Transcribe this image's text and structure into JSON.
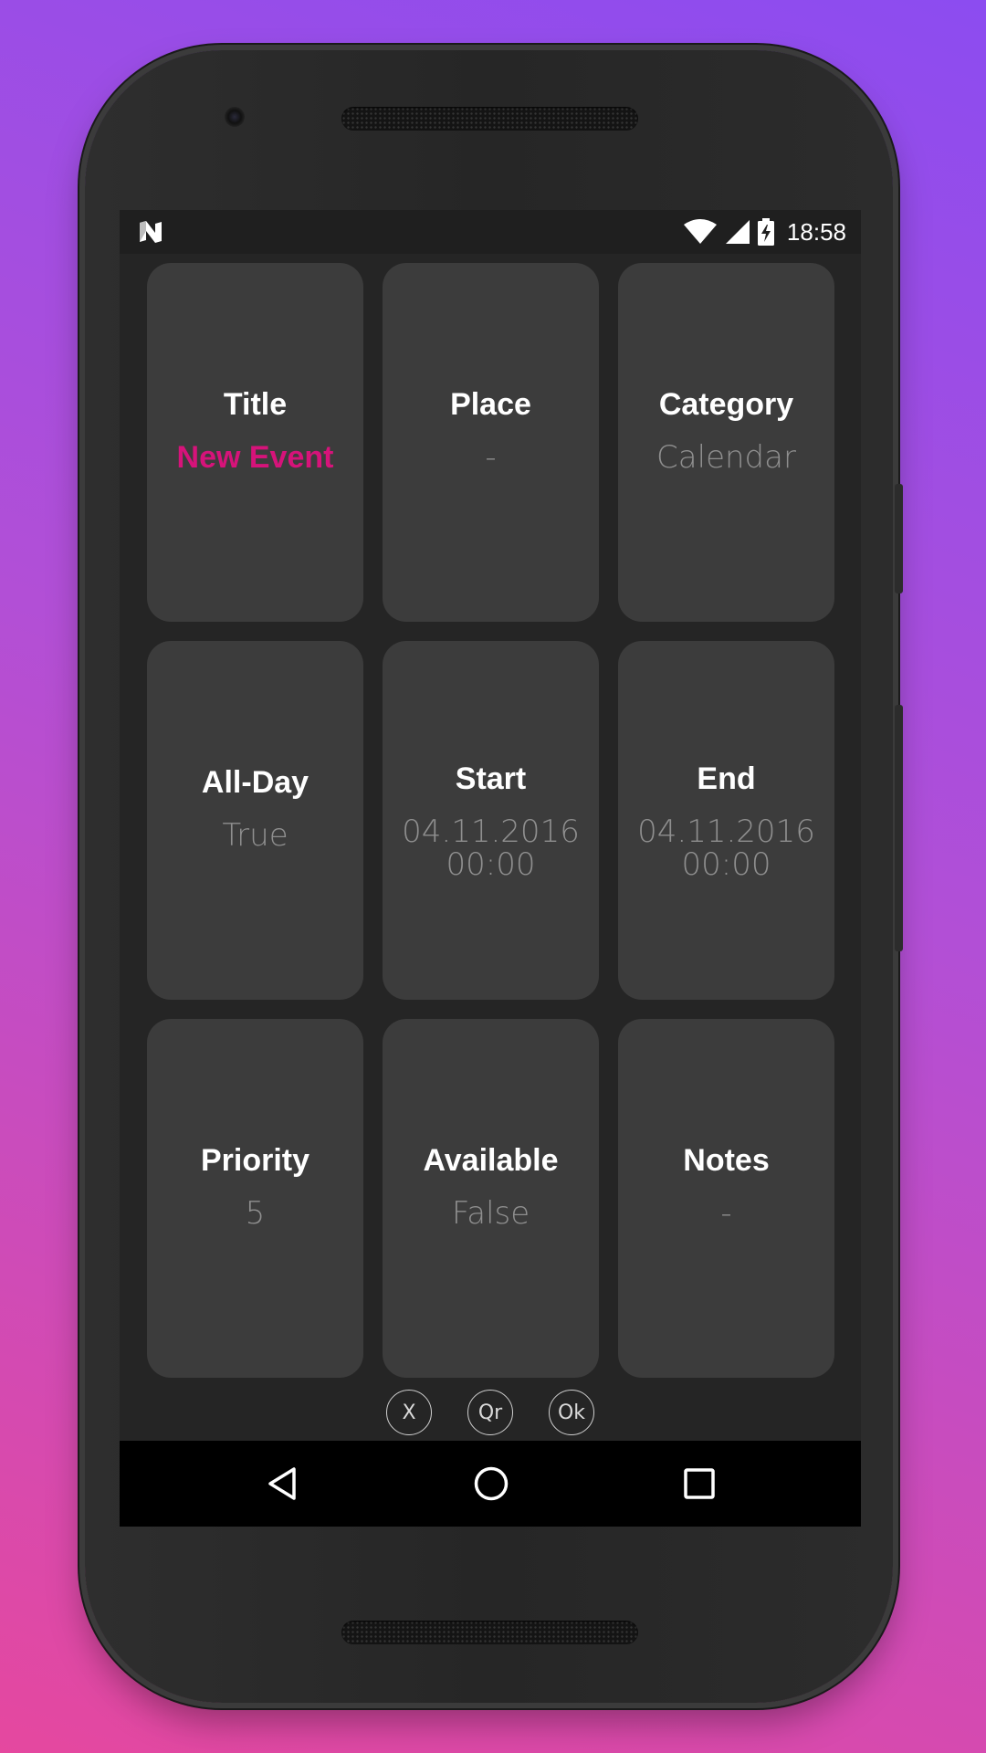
{
  "status_bar": {
    "time": "18:58",
    "icons": [
      "notification-n-icon",
      "wifi-icon",
      "signal-icon",
      "battery-charging-icon"
    ]
  },
  "fields": [
    {
      "label": "Title",
      "value": "New Event",
      "highlight": true
    },
    {
      "label": "Place",
      "value": "-"
    },
    {
      "label": "Category",
      "value": "Calendar"
    },
    {
      "label": "All-Day",
      "value": "True"
    },
    {
      "label": "Start",
      "value": "04.11.2016\n00:00"
    },
    {
      "label": "End",
      "value": "04.11.2016\n00:00"
    },
    {
      "label": "Priority",
      "value": "5"
    },
    {
      "label": "Available",
      "value": "False"
    },
    {
      "label": "Notes",
      "value": "-"
    }
  ],
  "actions": {
    "cancel": "X",
    "qr": "Qr",
    "ok": "Ok"
  },
  "nav": {
    "icons": [
      "back-icon",
      "home-icon",
      "recents-icon"
    ]
  },
  "colors": {
    "accent": "#d6137a",
    "card": "#3c3c3c",
    "screen": "#252525",
    "value": "#8f8f8f"
  }
}
